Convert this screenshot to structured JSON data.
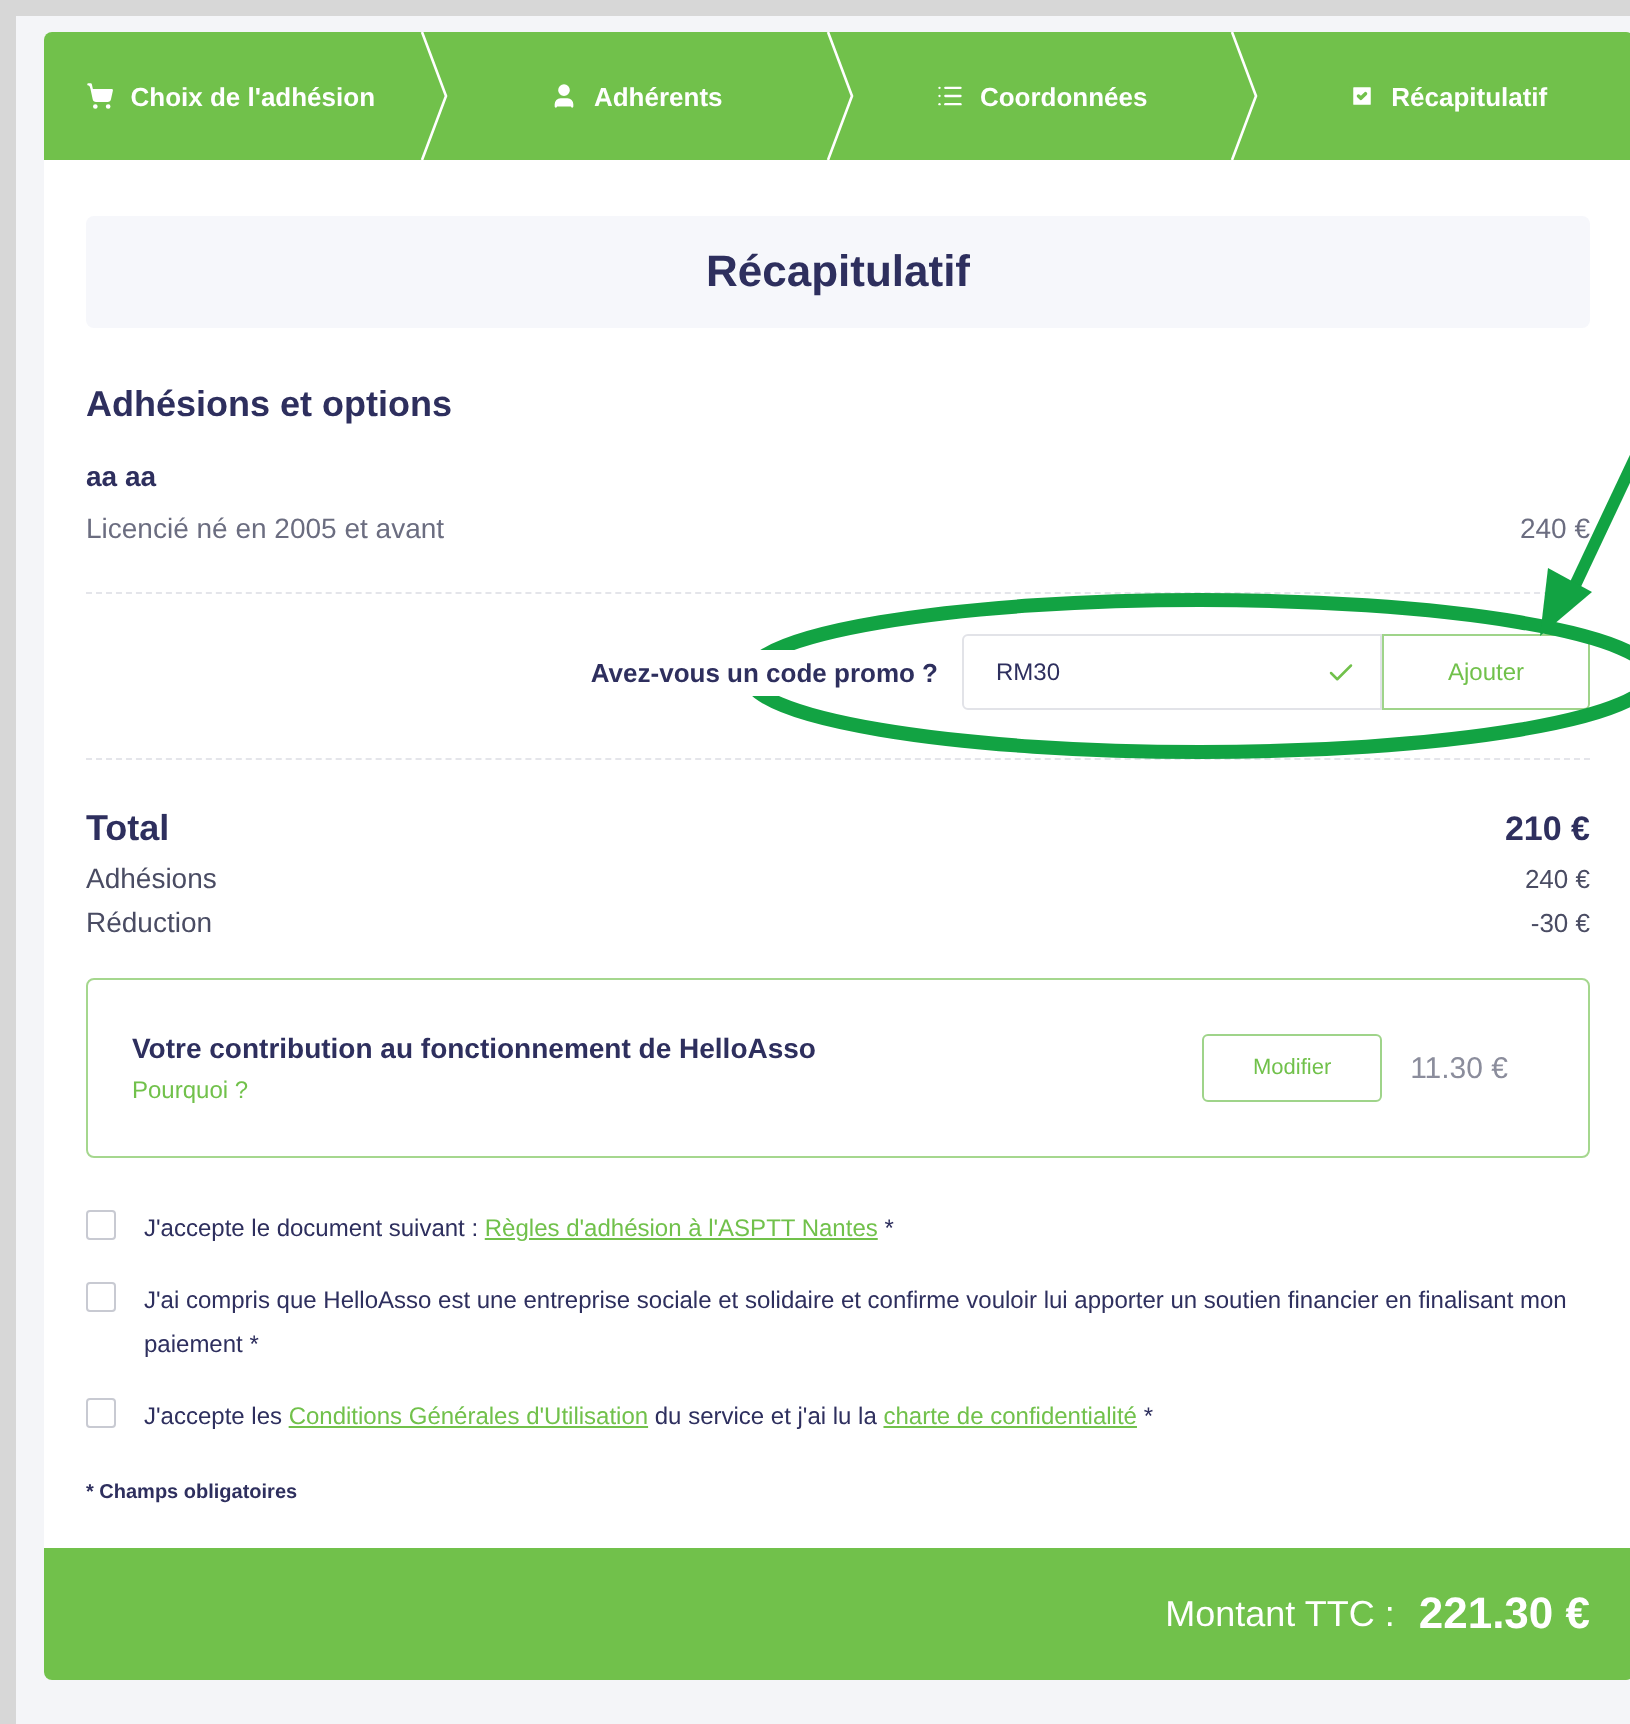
{
  "steps": [
    {
      "label": "Choix de l'adhésion",
      "kind": "cart"
    },
    {
      "label": "Adhérents",
      "kind": "user"
    },
    {
      "label": "Coordonnées",
      "kind": "list"
    },
    {
      "label": "Récapitulatif",
      "kind": "check"
    }
  ],
  "title": "Récapitulatif",
  "memberships": {
    "heading": "Adhésions et options",
    "name": "aa aa",
    "items": [
      {
        "label": "Licencié né en 2005 et avant",
        "price": "240 €"
      }
    ]
  },
  "promo": {
    "label": "Avez-vous un code promo ?",
    "value": "RM30",
    "valid": true,
    "button": "Ajouter"
  },
  "totals": {
    "label": "Total",
    "amount": "210 €",
    "lines": [
      {
        "label": "Adhésions",
        "amount": "240 €"
      },
      {
        "label": "Réduction",
        "amount": "-30 €"
      }
    ]
  },
  "contribution": {
    "title": "Votre contribution au fonctionnement de HelloAsso",
    "link": "Pourquoi ?",
    "button": "Modifier",
    "amount": "11.30 €"
  },
  "consents": [
    {
      "checked": false,
      "parts": [
        {
          "text": "J'accepte le document suivant : ",
          "link": false
        },
        {
          "text": "Règles d'adhésion à l'ASPTT Nantes",
          "link": true
        },
        {
          "text": " *",
          "link": false
        }
      ]
    },
    {
      "checked": false,
      "parts": [
        {
          "text": "J'ai compris que HelloAsso est une entreprise sociale et solidaire et confirme vouloir lui apporter un soutien financier en finalisant mon paiement *",
          "link": false
        }
      ]
    },
    {
      "checked": false,
      "parts": [
        {
          "text": "J'accepte les ",
          "link": false
        },
        {
          "text": "Conditions Générales d'Utilisation",
          "link": true
        },
        {
          "text": " du service et j'ai lu la ",
          "link": false
        },
        {
          "text": "charte de confidentialité",
          "link": true
        },
        {
          "text": " *",
          "link": false
        }
      ]
    }
  ],
  "required_note": "* Champs obligatoires",
  "footer": {
    "label": "Montant TTC :",
    "amount": "221.30 €"
  },
  "annotation": {
    "ellipse": true,
    "arrow": true
  }
}
